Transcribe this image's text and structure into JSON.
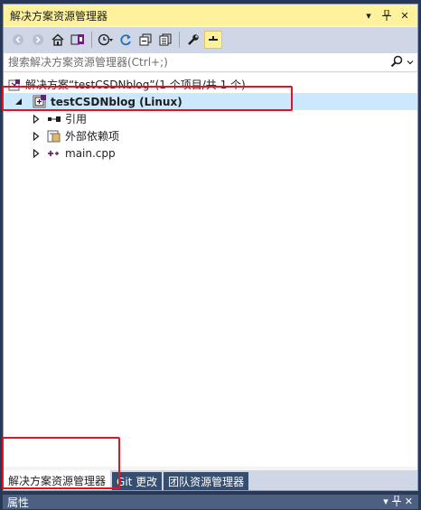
{
  "panel": {
    "title": "解决方案资源管理器",
    "buttons": {
      "dropdown": "▾",
      "pin": "⊥",
      "close": "✕"
    }
  },
  "toolbar": {
    "items": [
      "back-icon",
      "forward-icon",
      "home-icon",
      "switch-views-icon",
      "history-icon",
      "refresh-icon",
      "collapse-all-icon",
      "show-all-files-icon",
      "properties-wrench-icon",
      "preview-icon"
    ]
  },
  "search": {
    "placeholder": "搜索解决方案资源管理器(Ctrl+;)"
  },
  "tree": {
    "solution": "解决方案“testCSDNblog”(1 个项目/共 1 个)",
    "project": "testCSDNblog (Linux)",
    "children": [
      {
        "label": "引用",
        "icon": "references-icon"
      },
      {
        "label": "外部依赖项",
        "icon": "external-deps-icon"
      },
      {
        "label": "main.cpp",
        "icon": "cpp-file-icon"
      }
    ]
  },
  "tabs": [
    {
      "label": "解决方案资源管理器",
      "selected": true
    },
    {
      "label": "Git 更改",
      "selected": false
    },
    {
      "label": "团队资源管理器",
      "selected": false
    }
  ],
  "properties": {
    "title": "属性"
  },
  "colors": {
    "active_title": "#fff29d",
    "selection": "#cce8ff",
    "highlight_box": "#e81123",
    "frame": "#293955"
  }
}
